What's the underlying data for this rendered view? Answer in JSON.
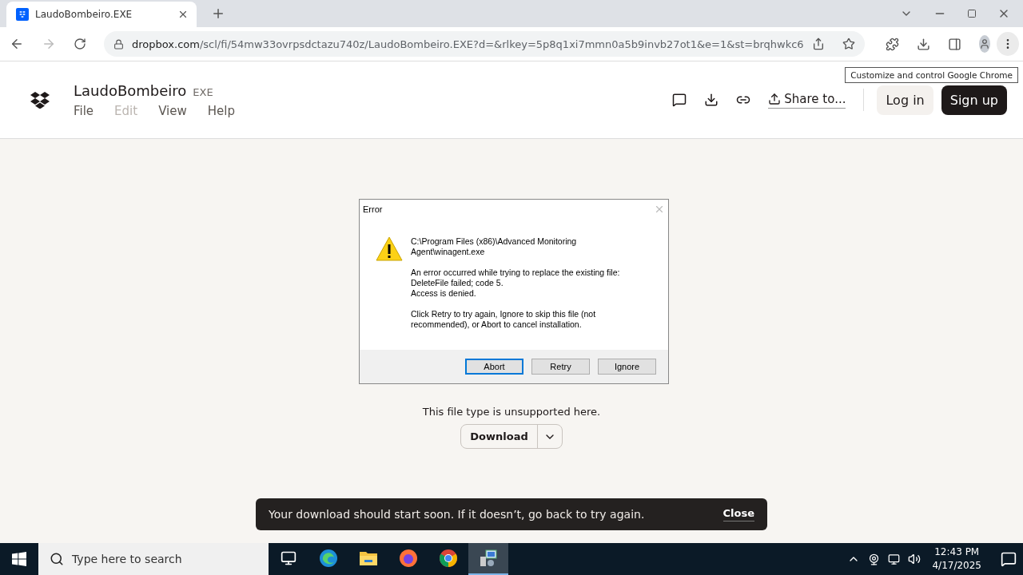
{
  "browser": {
    "tab": {
      "title": "LaudoBombeiro.EXE"
    },
    "url": {
      "host": "dropbox.com",
      "path": "/scl/fi/54mw33ovrpsdctazu740z/LaudoBombeiro.EXE?d=&rlkey=5p8q1xi7mmn0a5b9invb27ot1&e=1&st=brqhwkc6"
    },
    "tooltip": "Customize and control Google Chrome"
  },
  "header": {
    "file_name": "LaudoBombeiro",
    "file_ext": "EXE",
    "menu": [
      {
        "label": "File",
        "disabled": false
      },
      {
        "label": "Edit",
        "disabled": true
      },
      {
        "label": "View",
        "disabled": false
      },
      {
        "label": "Help",
        "disabled": false
      }
    ],
    "share_label": "Share to...",
    "login": "Log in",
    "signup": "Sign up"
  },
  "content": {
    "message": "This file type is unsupported here.",
    "download": "Download"
  },
  "dialog": {
    "title": "Error",
    "paragraphs": [
      "C:\\Program Files (x86)\\Advanced Monitoring Agent\\winagent.exe",
      "An error occurred while trying to replace the existing file:\nDeleteFile failed; code 5.\nAccess is denied.",
      "Click Retry to try again, Ignore to skip this file (not recommended), or Abort to cancel installation."
    ],
    "buttons": [
      {
        "label": "Abort",
        "selected": true
      },
      {
        "label": "Retry",
        "selected": false
      },
      {
        "label": "Ignore",
        "selected": false
      }
    ]
  },
  "toast": {
    "message": "Your download should start soon. If it doesn’t, go back to try again.",
    "close": "Close"
  },
  "taskbar": {
    "search_placeholder": "Type here to search",
    "apps": [
      {
        "kind": "taskview",
        "selected": false
      },
      {
        "kind": "edge",
        "selected": false
      },
      {
        "kind": "folder",
        "selected": false
      },
      {
        "kind": "firefox",
        "selected": false
      },
      {
        "kind": "chrome",
        "selected": false
      },
      {
        "kind": "installer",
        "selected": true
      }
    ],
    "time": "12:43 PM",
    "date": "4/17/2025"
  }
}
